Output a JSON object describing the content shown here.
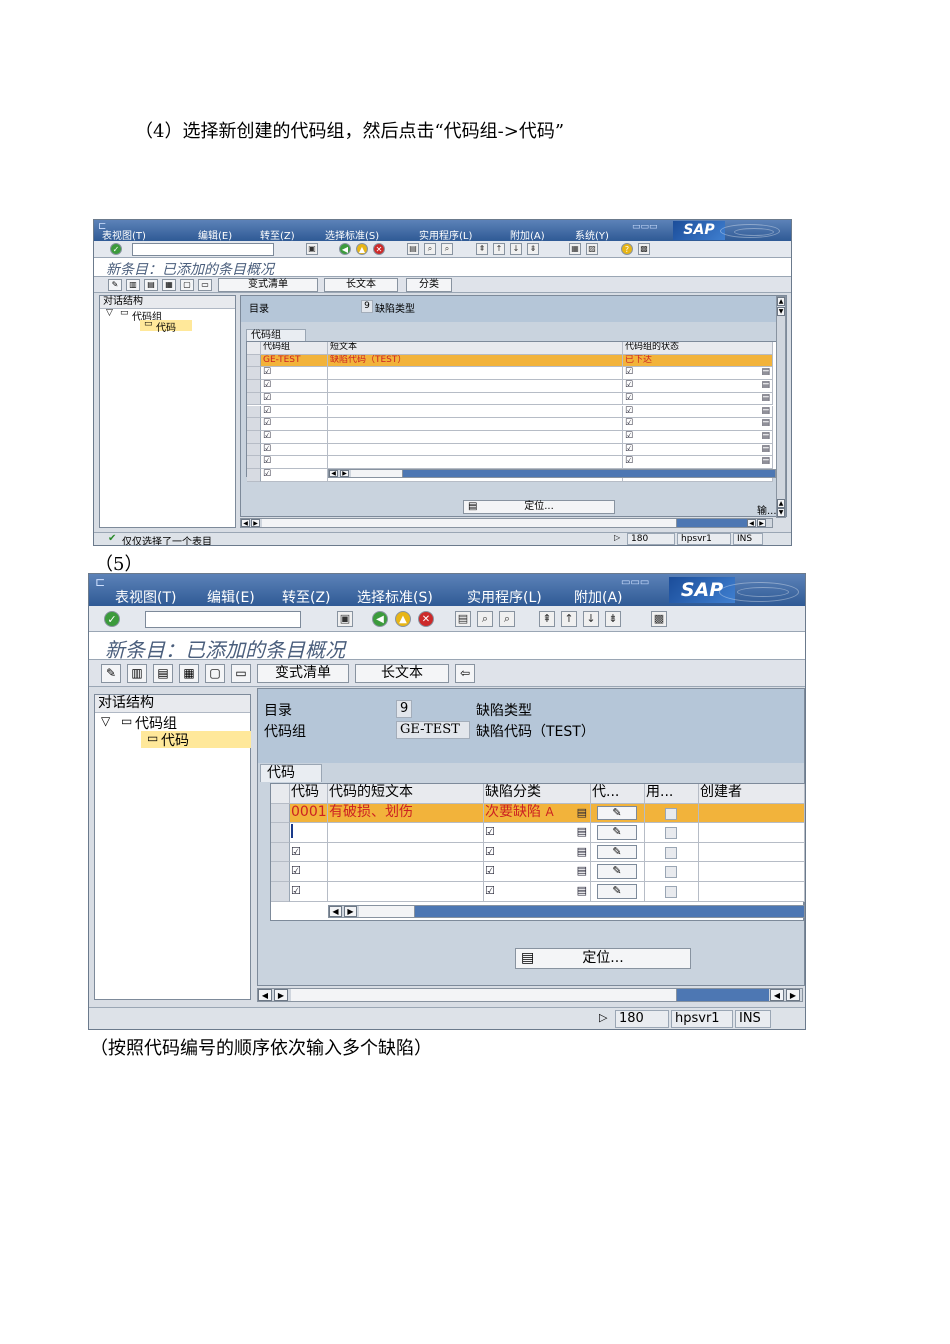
{
  "captions": {
    "step4": "（4）选择新创建的代码组，然后点击“代码组->代码”",
    "step5": "（5）",
    "note": "（按照代码编号的顺序依次输入多个缺陷）"
  },
  "menu": [
    "表视图(T)",
    "编辑(E)",
    "转至(Z)",
    "选择标准(S)",
    "实用程序(L)",
    "附加(A)",
    "系统(Y)"
  ],
  "menu2": [
    "表视图(T)",
    "编辑(E)",
    "转至(Z)",
    "选择标准(S)",
    "实用程序(L)",
    "附加(A)"
  ],
  "logo": "SAP",
  "screen1": {
    "title": "新条目：已添加的条目概况",
    "buttons": [
      "变式清单",
      "长文本",
      "分类"
    ],
    "tree_header": "对话结构",
    "tree": [
      "代码组",
      "代码"
    ],
    "catalog_label": "目录",
    "catalog_value": "9",
    "catalog_text": "缺陷类型",
    "frame_title": "代码组",
    "columns": [
      "代码组",
      "短文本",
      "代码组的状态"
    ],
    "rows": [
      {
        "code": "GE-TEST",
        "text": "缺陷代码（TEST）",
        "status": "已下达"
      }
    ],
    "position_button": "定位...",
    "input_label": "输...",
    "status_message": "仅仅选择了一个表目",
    "status_fields": [
      "180",
      "hpsvr1",
      "INS"
    ]
  },
  "screen2": {
    "title": "新条目：已添加的条目概况",
    "buttons": [
      "变式清单",
      "长文本"
    ],
    "tree_header": "对话结构",
    "tree": [
      "代码组",
      "代码"
    ],
    "catalog_label": "目录",
    "catalog_value": "9",
    "catalog_text": "缺陷类型",
    "group_label": "代码组",
    "group_value": "GE-TEST",
    "group_text": "缺陷代码（TEST）",
    "frame_title": "代码",
    "columns": [
      "代码",
      "代码的短文本",
      "缺陷分类",
      "代...",
      "用...",
      "创建者"
    ],
    "rows": [
      {
        "code": "0001",
        "text": "有破损、划伤",
        "class": "次要缺陷",
        "class_code": "A"
      }
    ],
    "position_button": "定位...",
    "status_fields": [
      "180",
      "hpsvr1",
      "INS"
    ]
  }
}
